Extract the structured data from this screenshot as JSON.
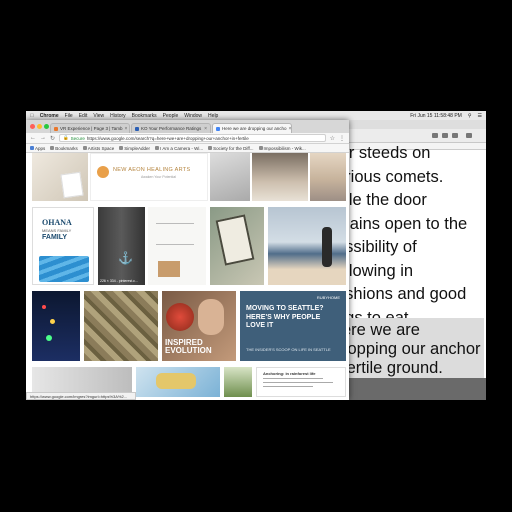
{
  "menubar": {
    "app": "Chrome",
    "items": [
      "File",
      "Edit",
      "View",
      "History",
      "Bookmarks",
      "People",
      "Window",
      "Help"
    ],
    "clock": "Fri Jun 15  11:58:48 PM"
  },
  "browser": {
    "tabs": [
      {
        "label": "VR Experience | Page 3 | Tamb"
      },
      {
        "label": "KO Your Performance Ratings"
      },
      {
        "label": "Here we are dropping our ancho"
      }
    ],
    "address": {
      "secure_label": "Secure",
      "url": "https://www.google.com/search?q=here+we+are+dropping+our+anchor+in+fertile"
    },
    "bookmarks": [
      "Apps",
      "Bookmarks",
      "Artists Space",
      "SimpleAdder",
      "I Am a Camera - Wi...",
      "Society for the Diff...",
      "Impossibilism - Wik..."
    ],
    "status_url": "https://www.google.com/imgres?imgurl=https%3A%2..."
  },
  "images": {
    "new_aeon_title": "NEW AEON HEALING ARTS",
    "new_aeon_sub": "Awaken Your Potential",
    "ohana_text": "OHANA",
    "ohana_sub": "MEANS FAMILY",
    "ohana_family": "FAMILY",
    "anchor_caption": "226 × 334 - pinterest.c...",
    "inspired_text": "INSPIRED EVOLUTION",
    "ruby_brand": "RUBYHOME",
    "ruby_headline": "MOVING TO SEATTLE? HERE'S WHY PEOPLE LOVE IT",
    "ruby_sub": "THE INSIDER'S SCOOP ON LIFE IN SEATTLE",
    "anchoring_title": "Anchoring: in rainforest life"
  },
  "document": {
    "lines": [
      "eir steeds on",
      "arious comets.",
      "hile the door",
      "mains open to the",
      "ossibility of",
      "allowing in",
      "ashions and good",
      "ngs to eat."
    ],
    "highlight_lines": [
      "ere we are",
      "ropping our anchor",
      "fertile ground."
    ]
  },
  "colors": {
    "close": "#ff5f57",
    "minimize": "#febc2e",
    "maximize": "#28c840",
    "ruby_blue": "#3f5f7a"
  }
}
